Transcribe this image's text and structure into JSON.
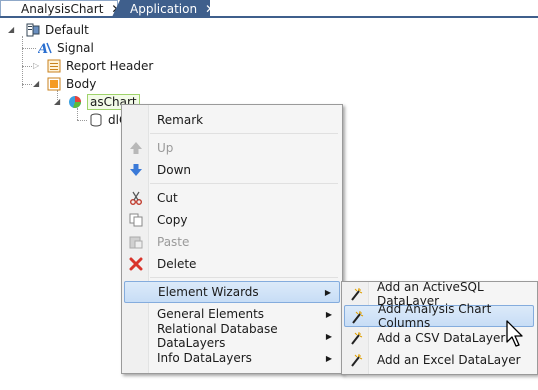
{
  "tabs": [
    {
      "label": "AnalysisChart",
      "close": "✕",
      "active": true
    },
    {
      "label": "Application",
      "close": "✕",
      "active": false
    }
  ],
  "tree": {
    "root": "Default",
    "signal": "Signal",
    "report_header": "Report Header",
    "body": "Body",
    "chart": "asChart",
    "child_partial": "dlC"
  },
  "context_menu": {
    "items": [
      "Remark",
      "Up",
      "Down",
      "Cut",
      "Copy",
      "Paste",
      "Delete",
      "Element Wizards",
      "General Elements",
      "Relational Database DataLayers",
      "Info DataLayers"
    ],
    "highlighted": "Element Wizards",
    "disabled": [
      "Up",
      "Paste"
    ]
  },
  "submenu": {
    "items": [
      "Add an ActiveSQL DataLayer",
      "Add Analysis Chart Columns",
      "Add a CSV DataLayer",
      "Add an Excel DataLayer"
    ],
    "highlighted": "Add Analysis Chart Columns"
  },
  "colors": {
    "tab_dark": "#3f5f8c",
    "highlight": "#c7ddf6",
    "highlight_border": "#84acdd",
    "delete_red": "#d9342b"
  }
}
